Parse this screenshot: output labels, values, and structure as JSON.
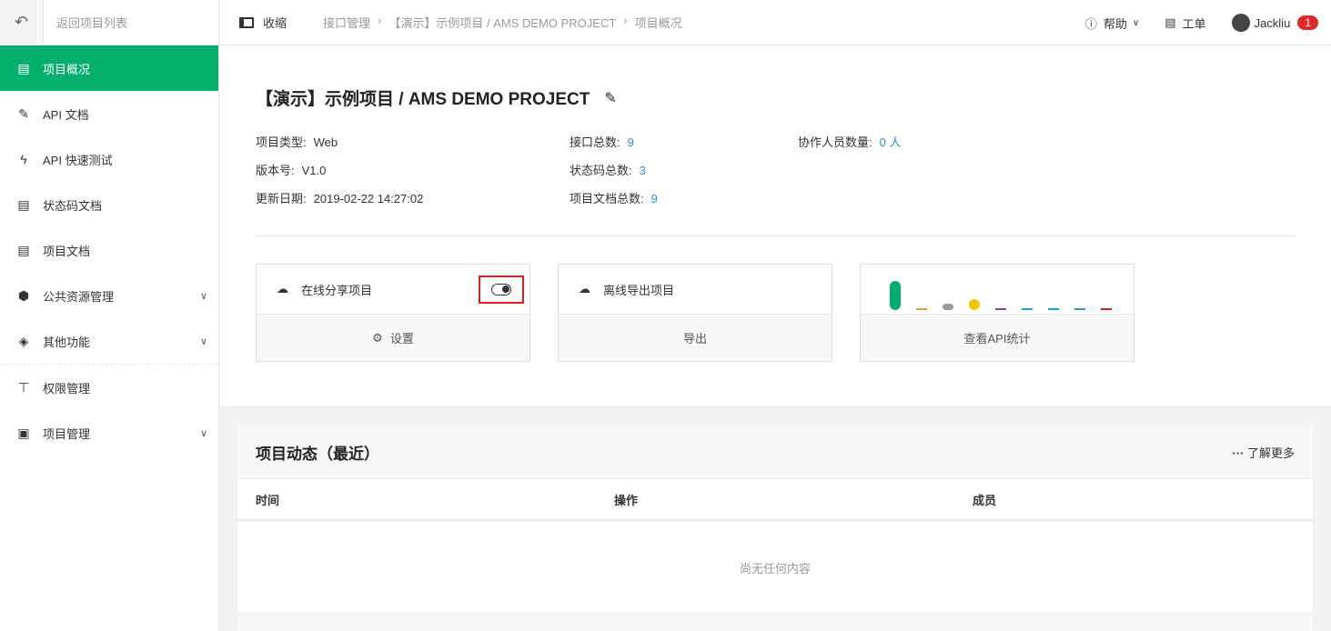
{
  "sidebar": {
    "back_label": "返回项目列表",
    "items": [
      {
        "label": "项目概况",
        "icon": "overview-icon",
        "glyph": "▤",
        "active": true
      },
      {
        "label": "API 文档",
        "icon": "ruler-icon",
        "glyph": "✎"
      },
      {
        "label": "API 快速测试",
        "icon": "bolt-icon",
        "glyph": "ϟ"
      },
      {
        "label": "状态码文档",
        "icon": "note-icon",
        "glyph": "▤"
      },
      {
        "label": "项目文档",
        "icon": "document-icon",
        "glyph": "▤"
      },
      {
        "label": "公共资源管理",
        "icon": "cube-icon",
        "glyph": "⬢",
        "expandable": true
      },
      {
        "label": "其他功能",
        "icon": "layers-icon",
        "glyph": "◈",
        "expandable": true
      },
      {
        "label": "权限管理",
        "icon": "org-chart-icon",
        "glyph": "⊤"
      },
      {
        "label": "项目管理",
        "icon": "clipboard-icon",
        "glyph": "▣",
        "expandable": true
      }
    ]
  },
  "topbar": {
    "collapse_label": "收缩",
    "breadcrumb": [
      "接口管理",
      "【演示】示例项目 / AMS DEMO PROJECT",
      "项目概况"
    ],
    "help_label": "帮助",
    "ticket_label": "工单",
    "user": "Jackliu",
    "notification_count": "1"
  },
  "project": {
    "title": "【演示】示例项目 / AMS DEMO PROJECT",
    "type_label": "项目类型:",
    "type": "Web",
    "version_label": "版本号:",
    "version": "V1.0",
    "updated_label": "更新日期:",
    "updated": "2019-02-22 14:27:02",
    "api_count_label": "接口总数:",
    "api_count": "9",
    "status_count_label": "状态码总数:",
    "status_count": "3",
    "doc_count_label": "项目文档总数:",
    "doc_count": "9",
    "members_label": "协作人员数量:",
    "members": "0 人"
  },
  "cards": {
    "share_label": "在线分享项目",
    "share_enabled": false,
    "settings_label": "设置",
    "export_title": "离线导出项目",
    "export_label": "导出",
    "stats_label": "查看API统计",
    "stats_bar_colors": [
      "#02ae6b",
      "#e3a33b",
      "#999999",
      "#f5c400",
      "#8e44ad",
      "#2b9bd0",
      "#2b9bd0",
      "#2b9bd0",
      "#c0262d"
    ]
  },
  "activity": {
    "title": "项目动态（最近）",
    "more_label": "了解更多",
    "columns": [
      "时间",
      "操作",
      "成员"
    ],
    "empty": "尚无任何内容"
  },
  "accent": "#02ae6b"
}
